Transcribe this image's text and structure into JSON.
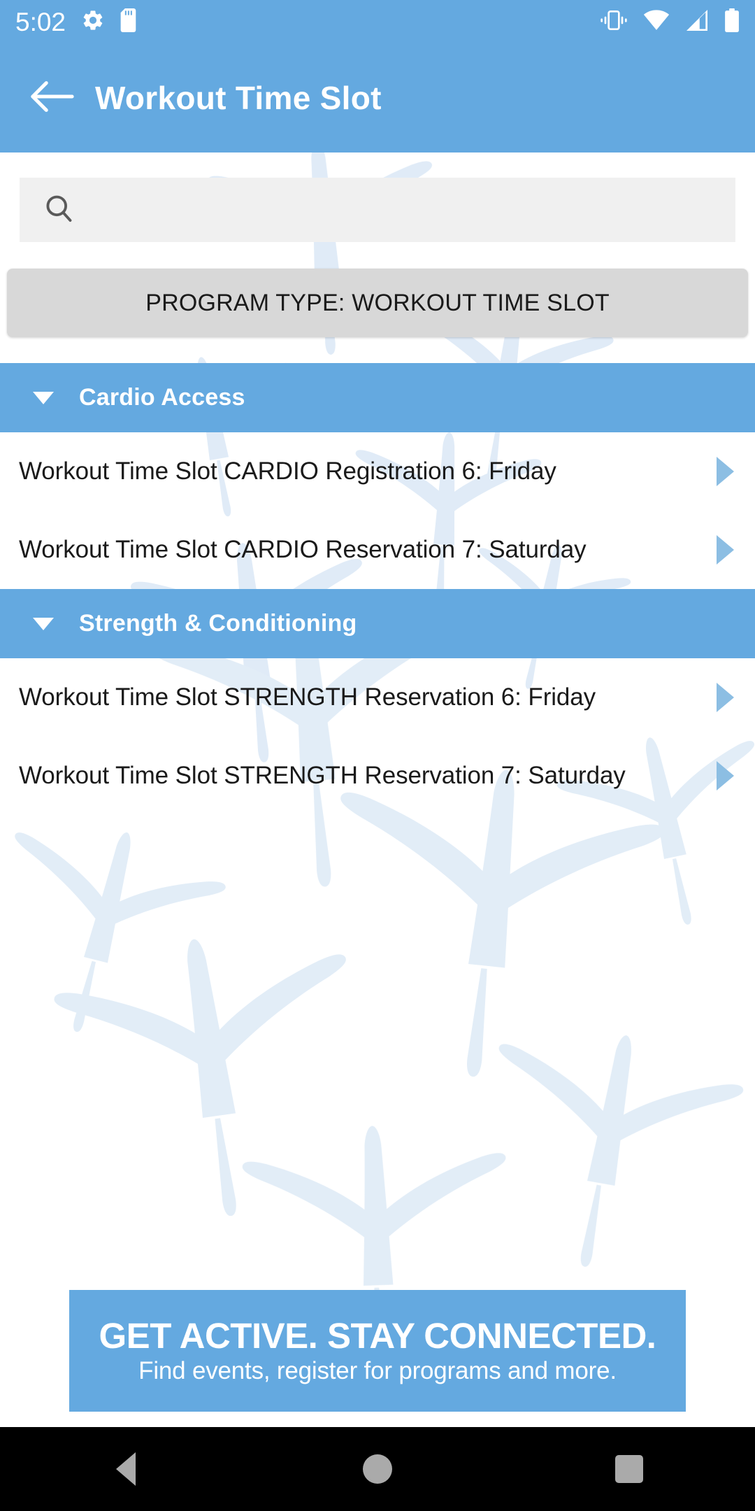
{
  "status_bar": {
    "time": "5:02",
    "left_icons": [
      "gear-icon",
      "sd-card-icon"
    ],
    "right_icons": [
      "vibrate-icon",
      "wifi-icon",
      "cellular-signal-icon",
      "battery-icon"
    ]
  },
  "app_bar": {
    "back_icon": "arrow-left-icon",
    "title": "Workout Time Slot"
  },
  "search": {
    "icon": "search-icon",
    "value": "",
    "placeholder": ""
  },
  "filter_chip": {
    "label": "PROGRAM TYPE: WORKOUT TIME SLOT"
  },
  "sections": [
    {
      "title": "Cardio Access",
      "expanded": true,
      "caret_icon": "caret-down-icon",
      "rows": [
        {
          "label": "Workout Time Slot CARDIO Registration 6: Friday",
          "arrow_icon": "caret-right-icon"
        },
        {
          "label": "Workout Time Slot CARDIO Reservation 7: Saturday",
          "arrow_icon": "caret-right-icon"
        }
      ]
    },
    {
      "title": "Strength & Conditioning",
      "expanded": true,
      "caret_icon": "caret-down-icon",
      "rows": [
        {
          "label": "Workout Time Slot STRENGTH Reservation 6: Friday",
          "arrow_icon": "caret-right-icon"
        },
        {
          "label": "Workout Time Slot STRENGTH Reservation 7: Saturday",
          "arrow_icon": "caret-right-icon"
        }
      ]
    }
  ],
  "promo_banner": {
    "title": "GET ACTIVE.  STAY CONNECTED.",
    "subtitle": "Find events, register for programs and more."
  },
  "nav_bar": {
    "back": "nav-back-icon",
    "home": "nav-home-icon",
    "recents": "nav-recents-icon"
  },
  "colors": {
    "primary_blue": "#64A9E0",
    "arrow_blue": "#8CBEE3",
    "chip_gray": "#D8D8D8",
    "search_gray": "#F0F0F0",
    "watermark_blue": "#E2EDF7",
    "text_dark": "#1a1a1a",
    "nav_bar_black": "#000000"
  }
}
